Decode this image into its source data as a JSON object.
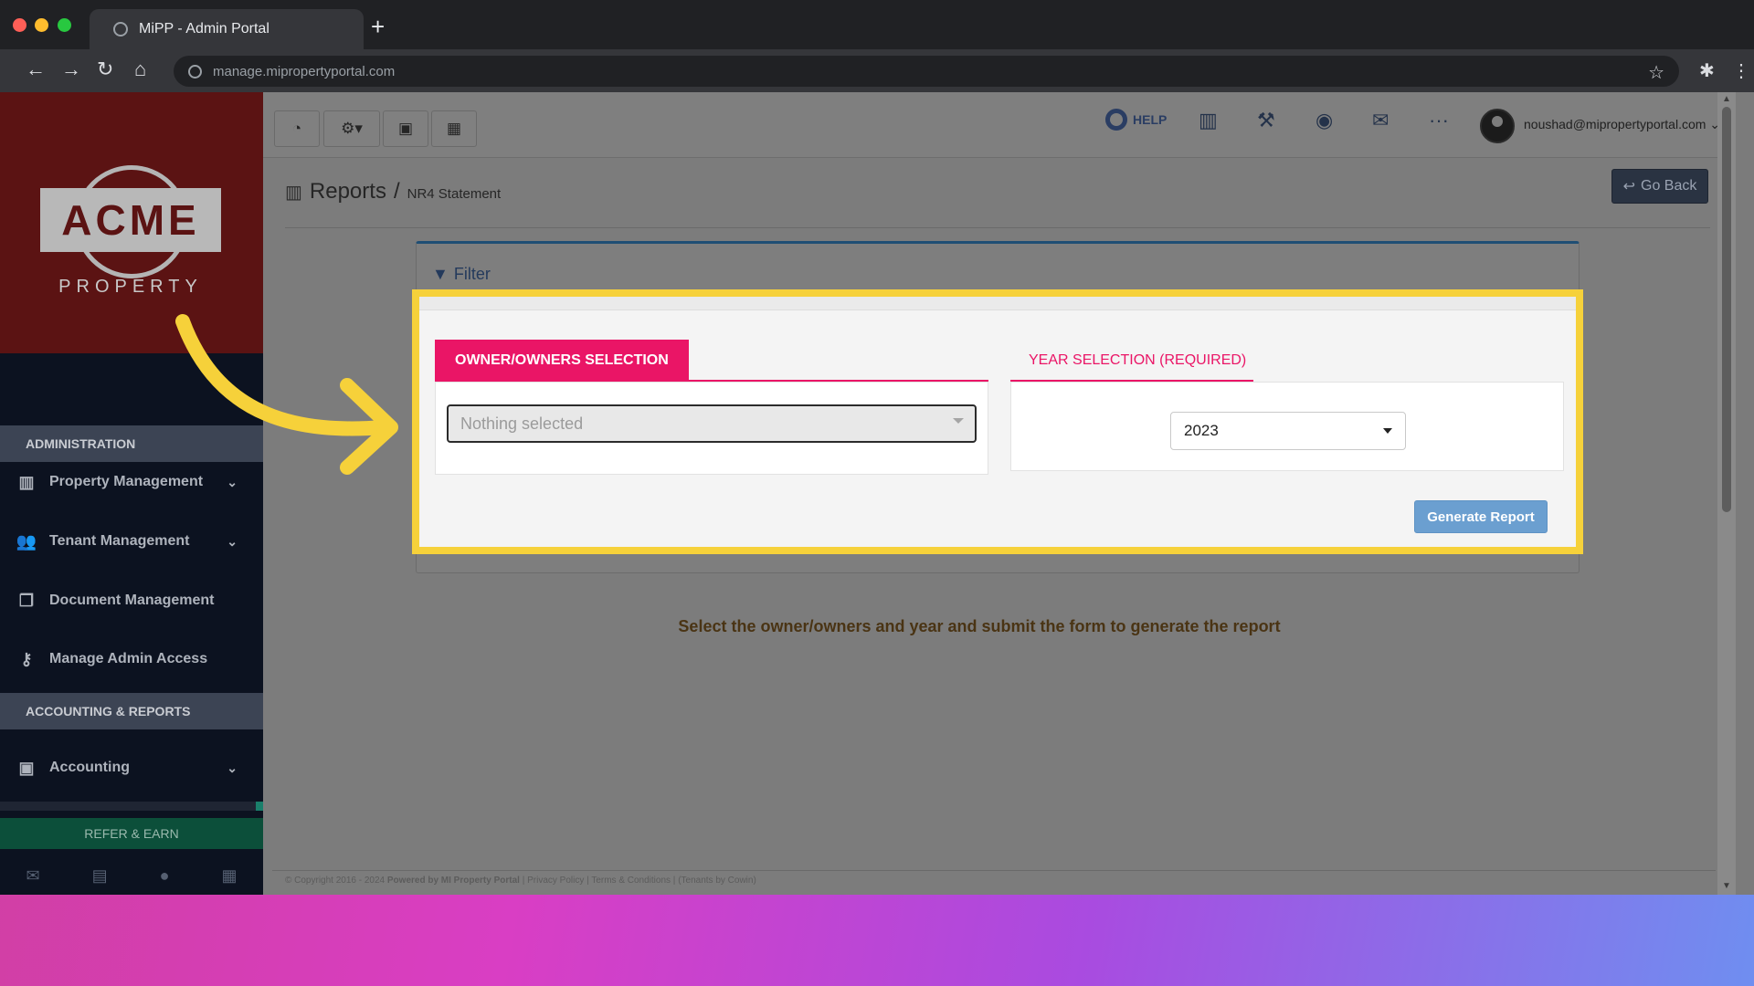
{
  "browser": {
    "tab_title": "MiPP - Admin Portal",
    "url": "manage.mipropertyportal.com"
  },
  "logo": {
    "main": "ACME",
    "sub": "PROPERTY"
  },
  "sidebar": {
    "sections": [
      {
        "label": "ADMINISTRATION"
      },
      {
        "label": "ACCOUNTING & REPORTS"
      }
    ],
    "items": [
      {
        "label": "Property Management",
        "icon": "building-icon"
      },
      {
        "label": "Tenant Management",
        "icon": "users-icon"
      },
      {
        "label": "Document Management",
        "icon": "documents-icon"
      },
      {
        "label": "Manage Admin Access",
        "icon": "key-icon"
      },
      {
        "label": "Accounting",
        "icon": "money-icon"
      }
    ],
    "refer_label": "REFER & EARN"
  },
  "topbar": {
    "help_label": "HELP",
    "user_email": "noushad@mipropertyportal.com"
  },
  "breadcrumb": {
    "title": "Reports",
    "separator": "/",
    "current": "NR4 Statement"
  },
  "go_back_label": "Go Back",
  "filter": {
    "title": "Filter",
    "owner_tab": "OWNER/OWNERS SELECTION",
    "owner_placeholder": "Nothing selected",
    "year_tab": "YEAR SELECTION (REQUIRED)",
    "year_value": "2023",
    "generate_label": "Generate Report"
  },
  "message": "Select the owner/owners and year and submit the form to generate the report",
  "footer": {
    "copyright": "© Copyright 2016 - 2024",
    "powered": "Powered by MI Property Portal",
    "links": [
      "Privacy Policy",
      "Terms & Conditions"
    ],
    "credit": "(Tenants by Cowin)"
  },
  "colors": {
    "accent_pink": "#ea1566",
    "highlight_yellow": "#f6d13a",
    "brand_red": "#5b1313",
    "generate_blue": "#6b9fd0"
  }
}
